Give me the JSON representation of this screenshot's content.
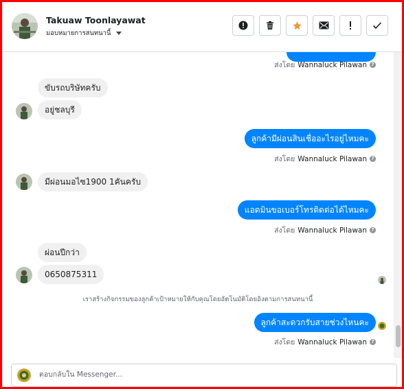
{
  "header": {
    "name": "Takuaw Toonlayawat",
    "assign_label": "มอบหมายการสนทนานี้",
    "toolbar": [
      {
        "name": "report-button",
        "icon": "exclamation-circle-icon"
      },
      {
        "name": "delete-button",
        "icon": "trash-icon"
      },
      {
        "name": "star-button",
        "icon": "star-icon"
      },
      {
        "name": "mark-unread-button",
        "icon": "envelope-icon"
      },
      {
        "name": "mark-spam-button",
        "icon": "exclamation-icon"
      },
      {
        "name": "mark-done-button",
        "icon": "check-icon"
      }
    ]
  },
  "colors": {
    "accent": "#0084ff",
    "incoming_bubble": "#f1f0f0",
    "star": "#f7923a",
    "frame": "#ff0000"
  },
  "messages": {
    "sent_by_prefix": "ส่งโดย",
    "agent_name": "Wannaluck Pilawan",
    "in1": "ขับรถบริษัทครับ",
    "in2": "อยู่ชลบุรี",
    "out1": "ลูกค้ามีผ่อนสินเชื่ออะไรอยู่ไหมคะ",
    "in3": "มีผ่อนมอไซ1900 1คันครับ",
    "out2": "แอดมินขอเบอร์โทรติดต่อได้ไหมคะ",
    "in4": "ผ่อนปีกว่า",
    "in5": "0650875311",
    "system_note": "เราสร้างกิจกรรมของลูกค้าเป้าหมายให้กับคุณโดยอัตโนมัติโดยอิงตามการสนทนานี้",
    "out3": "ลูกค้าสะดวกรับสายช่วงไหนคะ"
  },
  "composer": {
    "placeholder": "ตอบกลับใน Messenger..."
  }
}
